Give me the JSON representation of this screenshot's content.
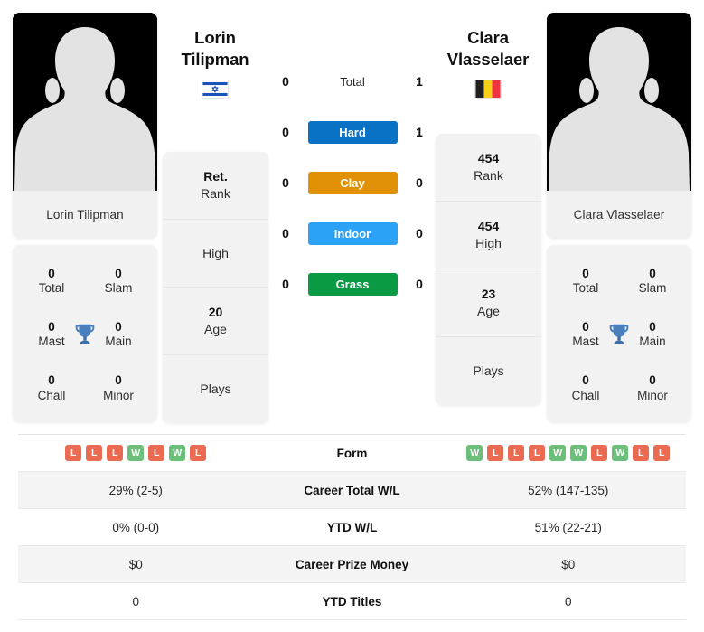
{
  "players": {
    "left": {
      "first_name": "Lorin",
      "last_name": "Tilipman",
      "full_name": "Lorin Tilipman",
      "country": "Israel",
      "flag_icon": "flag-israel-icon",
      "avatar_icon": "avatar-silhouette-icon",
      "stats": [
        {
          "value": "Ret.",
          "label": "Rank"
        },
        {
          "value": "",
          "label": "High"
        },
        {
          "value": "20",
          "label": "Age"
        },
        {
          "value": "",
          "label": "Plays"
        }
      ],
      "titles": [
        {
          "value": "0",
          "label": "Total"
        },
        {
          "value": "0",
          "label": "Slam"
        },
        {
          "value": "0",
          "label": "Mast"
        },
        {
          "value": "0",
          "label": "Main"
        },
        {
          "value": "0",
          "label": "Chall"
        },
        {
          "value": "0",
          "label": "Minor"
        }
      ],
      "form": [
        "L",
        "L",
        "L",
        "W",
        "L",
        "W",
        "L"
      ],
      "career_total_wl": "29% (2-5)",
      "ytd_wl": "0% (0-0)",
      "career_prize_money": "$0",
      "ytd_titles": "0"
    },
    "right": {
      "first_name": "Clara",
      "last_name": "Vlasselaer",
      "full_name": "Clara Vlasselaer",
      "country": "Belgium",
      "flag_icon": "flag-belgium-icon",
      "avatar_icon": "avatar-silhouette-icon",
      "stats": [
        {
          "value": "454",
          "label": "Rank"
        },
        {
          "value": "454",
          "label": "High"
        },
        {
          "value": "23",
          "label": "Age"
        },
        {
          "value": "",
          "label": "Plays"
        }
      ],
      "titles": [
        {
          "value": "0",
          "label": "Total"
        },
        {
          "value": "0",
          "label": "Slam"
        },
        {
          "value": "0",
          "label": "Mast"
        },
        {
          "value": "0",
          "label": "Main"
        },
        {
          "value": "0",
          "label": "Chall"
        },
        {
          "value": "0",
          "label": "Minor"
        }
      ],
      "form": [
        "W",
        "L",
        "L",
        "L",
        "W",
        "W",
        "L",
        "W",
        "L",
        "L"
      ],
      "career_total_wl": "52% (147-135)",
      "ytd_wl": "51% (22-21)",
      "career_prize_money": "$0",
      "ytd_titles": "0"
    }
  },
  "titles_trophy_icon": "trophy-icon",
  "h2h": {
    "rows": [
      {
        "left": "0",
        "label": "Total",
        "right": "1",
        "style": "plain",
        "color": ""
      },
      {
        "left": "0",
        "label": "Hard",
        "right": "1",
        "style": "badge",
        "color": "#0a72c4"
      },
      {
        "left": "0",
        "label": "Clay",
        "right": "0",
        "style": "badge",
        "color": "#e09106"
      },
      {
        "left": "0",
        "label": "Indoor",
        "right": "0",
        "style": "badge",
        "color": "#2ca2f7"
      },
      {
        "left": "0",
        "label": "Grass",
        "right": "0",
        "style": "badge",
        "color": "#099a43"
      }
    ]
  },
  "table": {
    "rows": [
      {
        "label": "Form",
        "type": "form"
      },
      {
        "label": "Career Total W/L",
        "type": "text",
        "key": "career_total_wl"
      },
      {
        "label": "YTD W/L",
        "type": "text",
        "key": "ytd_wl"
      },
      {
        "label": "Career Prize Money",
        "type": "text",
        "key": "career_prize_money"
      },
      {
        "label": "YTD Titles",
        "type": "text",
        "key": "ytd_titles"
      }
    ]
  },
  "colors": {
    "win_badge": "#6cbf7a",
    "loss_badge": "#ea6a52",
    "card_bg": "#f2f2f2",
    "row_alt_bg": "#f4f4f4"
  }
}
